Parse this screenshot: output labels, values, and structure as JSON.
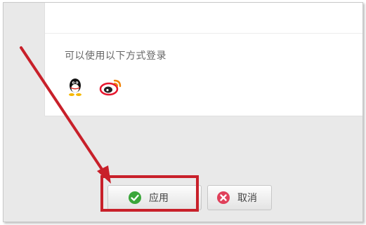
{
  "login": {
    "prompt": "可以使用以下方式登录",
    "methods": [
      {
        "name": "QQ",
        "icon": "qq-penguin-icon"
      },
      {
        "name": "Weibo",
        "icon": "weibo-icon"
      }
    ]
  },
  "buttons": {
    "apply_label": "应用",
    "apply_icon": "check-icon",
    "cancel_label": "取消",
    "cancel_icon": "close-circle-icon"
  },
  "annotation": {
    "color": "#c8202a",
    "type": "arrow-pointing-to-apply-button"
  },
  "colors": {
    "check": "#3aa63a",
    "cancel": "#e0405a",
    "weibo": "#e6162d"
  }
}
